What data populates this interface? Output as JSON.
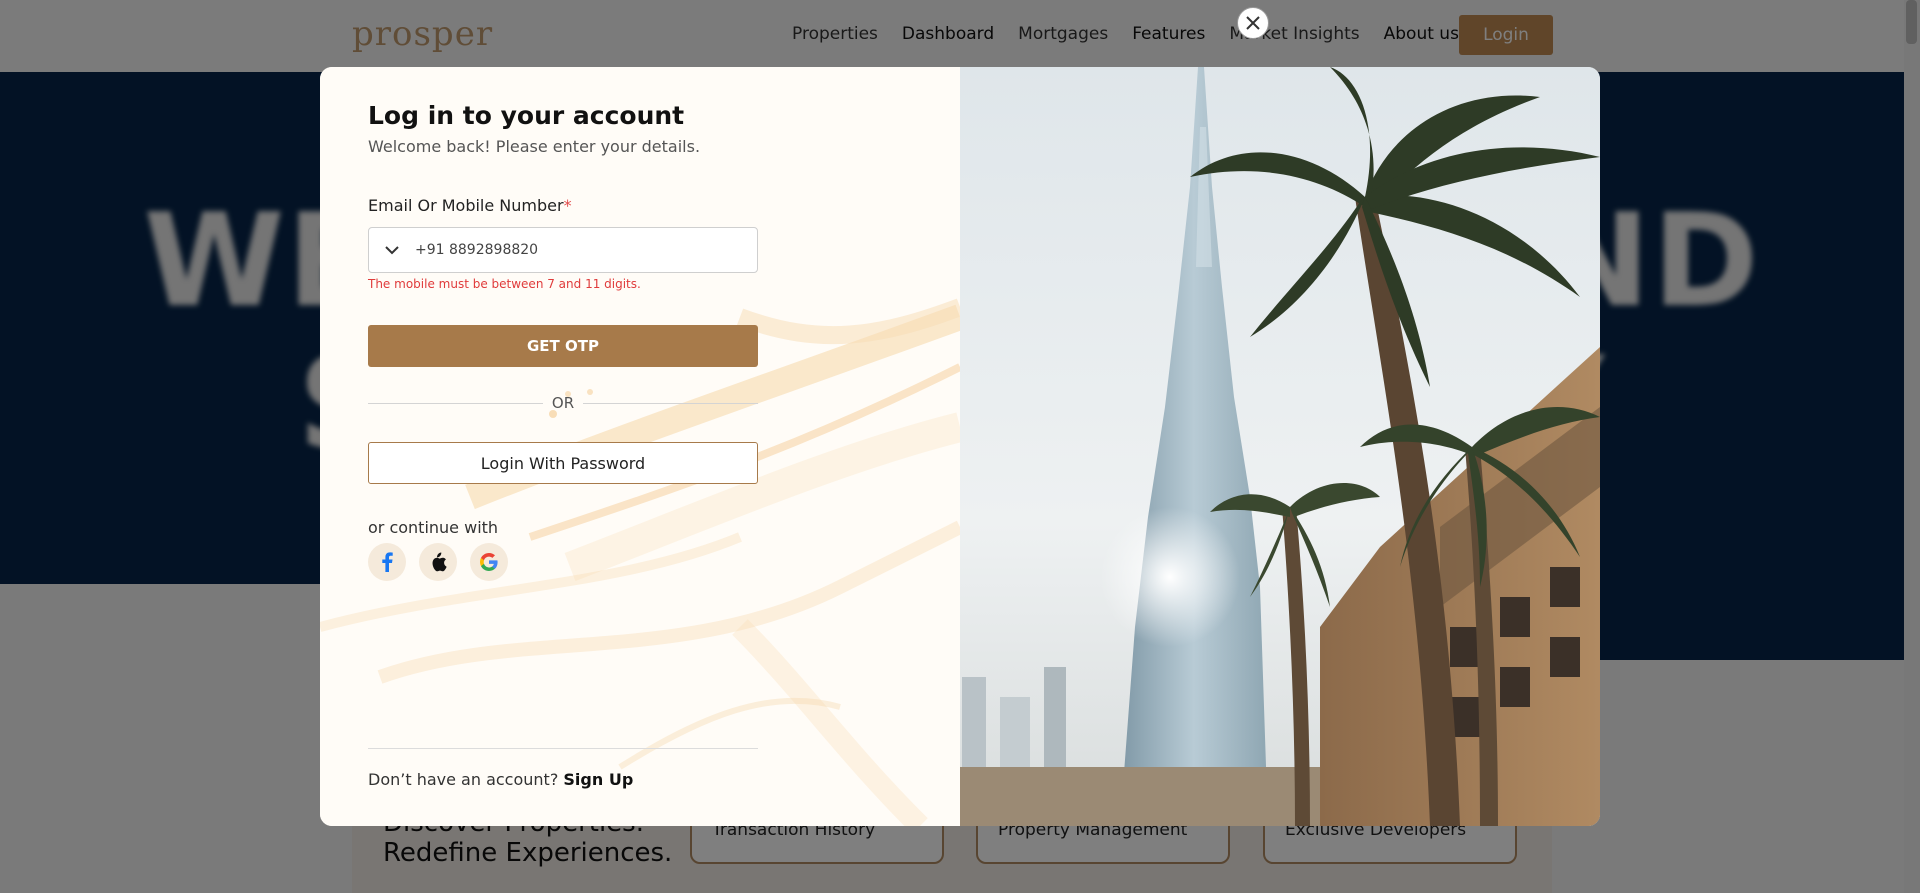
{
  "background": {
    "logo": "prosper",
    "nav": {
      "items": [
        "Properties",
        "Dashboard",
        "Mortgages",
        "Features",
        "Market Insights",
        "About us"
      ],
      "login_label": "Login"
    },
    "hero": {
      "line1": "WE BUILD TRUST AND",
      "line2": "SMART STRATEGY"
    },
    "lower": {
      "heading_line1": "Discover Properties.",
      "heading_line2": "Redefine Experiences.",
      "cards": [
        "Transaction History",
        "Property Management",
        "Exclusive Developers"
      ]
    }
  },
  "modal": {
    "title": "Log in to your account",
    "subtitle": "Welcome back! Please enter your details.",
    "field_label": "Email Or Mobile Number",
    "required_mark": "*",
    "phone_value": "+91 8892898820",
    "error": "The mobile must be between 7 and 11 digits.",
    "get_otp_label": "GET OTP",
    "or_label": "OR",
    "password_login_label": "Login With Password",
    "continue_label": "or continue with",
    "social_icons": [
      "facebook-icon",
      "apple-icon",
      "google-icon"
    ],
    "footer_text": "Don’t have an account?",
    "signup_label": "Sign Up"
  },
  "colors": {
    "brand": "#a77a4a",
    "hero_bg": "#06254a",
    "error": "#e03b3b"
  }
}
